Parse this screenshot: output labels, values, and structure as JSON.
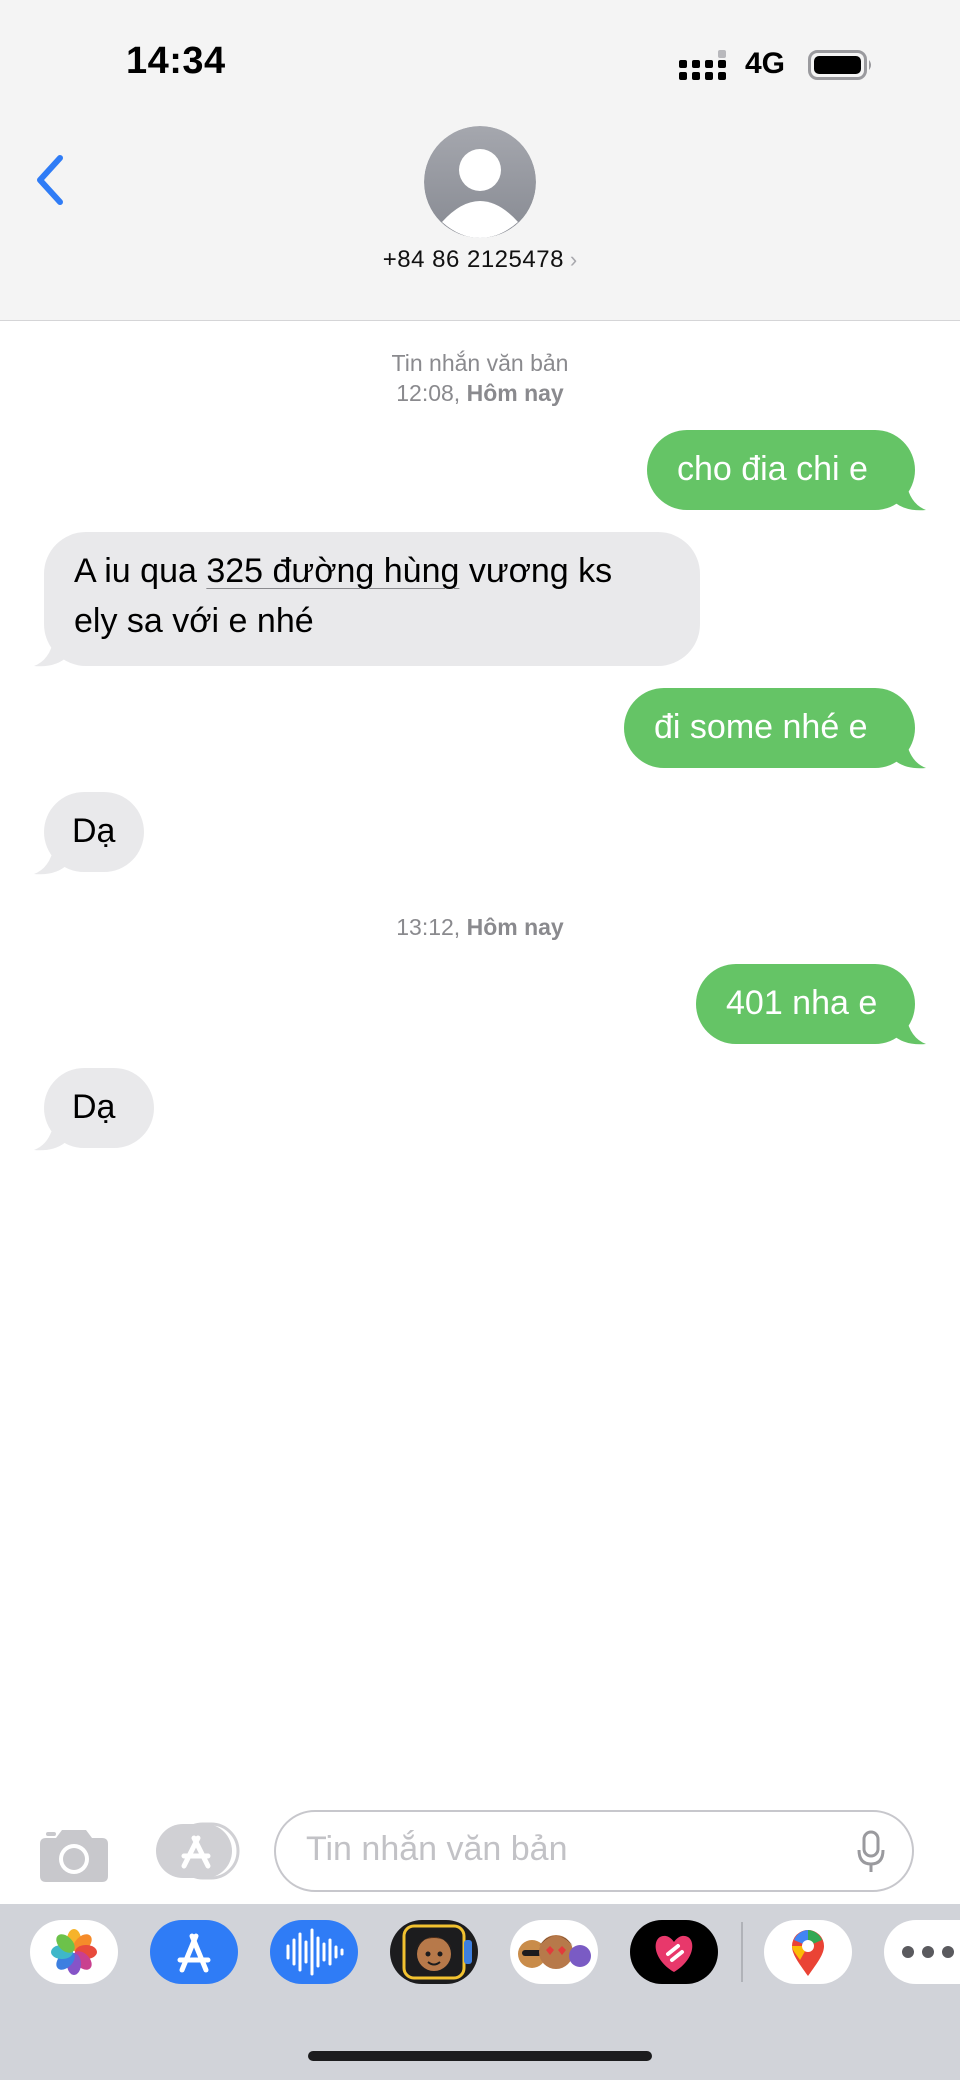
{
  "status_bar": {
    "time": "14:34",
    "network": "4G"
  },
  "header": {
    "contact_number": "+84 86 2125478",
    "chevron": "›"
  },
  "thread": {
    "meta1_line1": "Tin nhắn văn bản",
    "meta1_line2_time": "12:08,",
    "meta1_line2_day": "Hôm nay",
    "messages": [
      {
        "direction": "sent",
        "text": "cho đia chi e"
      },
      {
        "direction": "received",
        "text_a": "A iu qua ",
        "text_link": "325 đường hùng",
        "text_b": " vương ks",
        "text_line2": "ely sa với e nhé"
      },
      {
        "direction": "sent",
        "text": "đi some nhé e"
      },
      {
        "direction": "received",
        "text": "Dạ"
      },
      {
        "direction": "sent",
        "text": "401 nha e"
      },
      {
        "direction": "received",
        "text": "Dạ"
      }
    ],
    "meta2_time": "13:12,",
    "meta2_day": "Hôm nay"
  },
  "input": {
    "placeholder": "Tin nhắn văn bản"
  },
  "app_drawer": [
    {
      "name": "photos-app-icon"
    },
    {
      "name": "app-store-icon"
    },
    {
      "name": "audio-message-icon"
    },
    {
      "name": "memoji-stickers-icon"
    },
    {
      "name": "animoji-icon"
    },
    {
      "name": "digital-touch-icon"
    },
    {
      "name": "google-maps-icon"
    },
    {
      "name": "more-apps-icon"
    }
  ],
  "colors": {
    "sent_bubble": "#65c466",
    "received_bubble": "#e9e9eb",
    "accent_blue": "#2f7cf6"
  }
}
